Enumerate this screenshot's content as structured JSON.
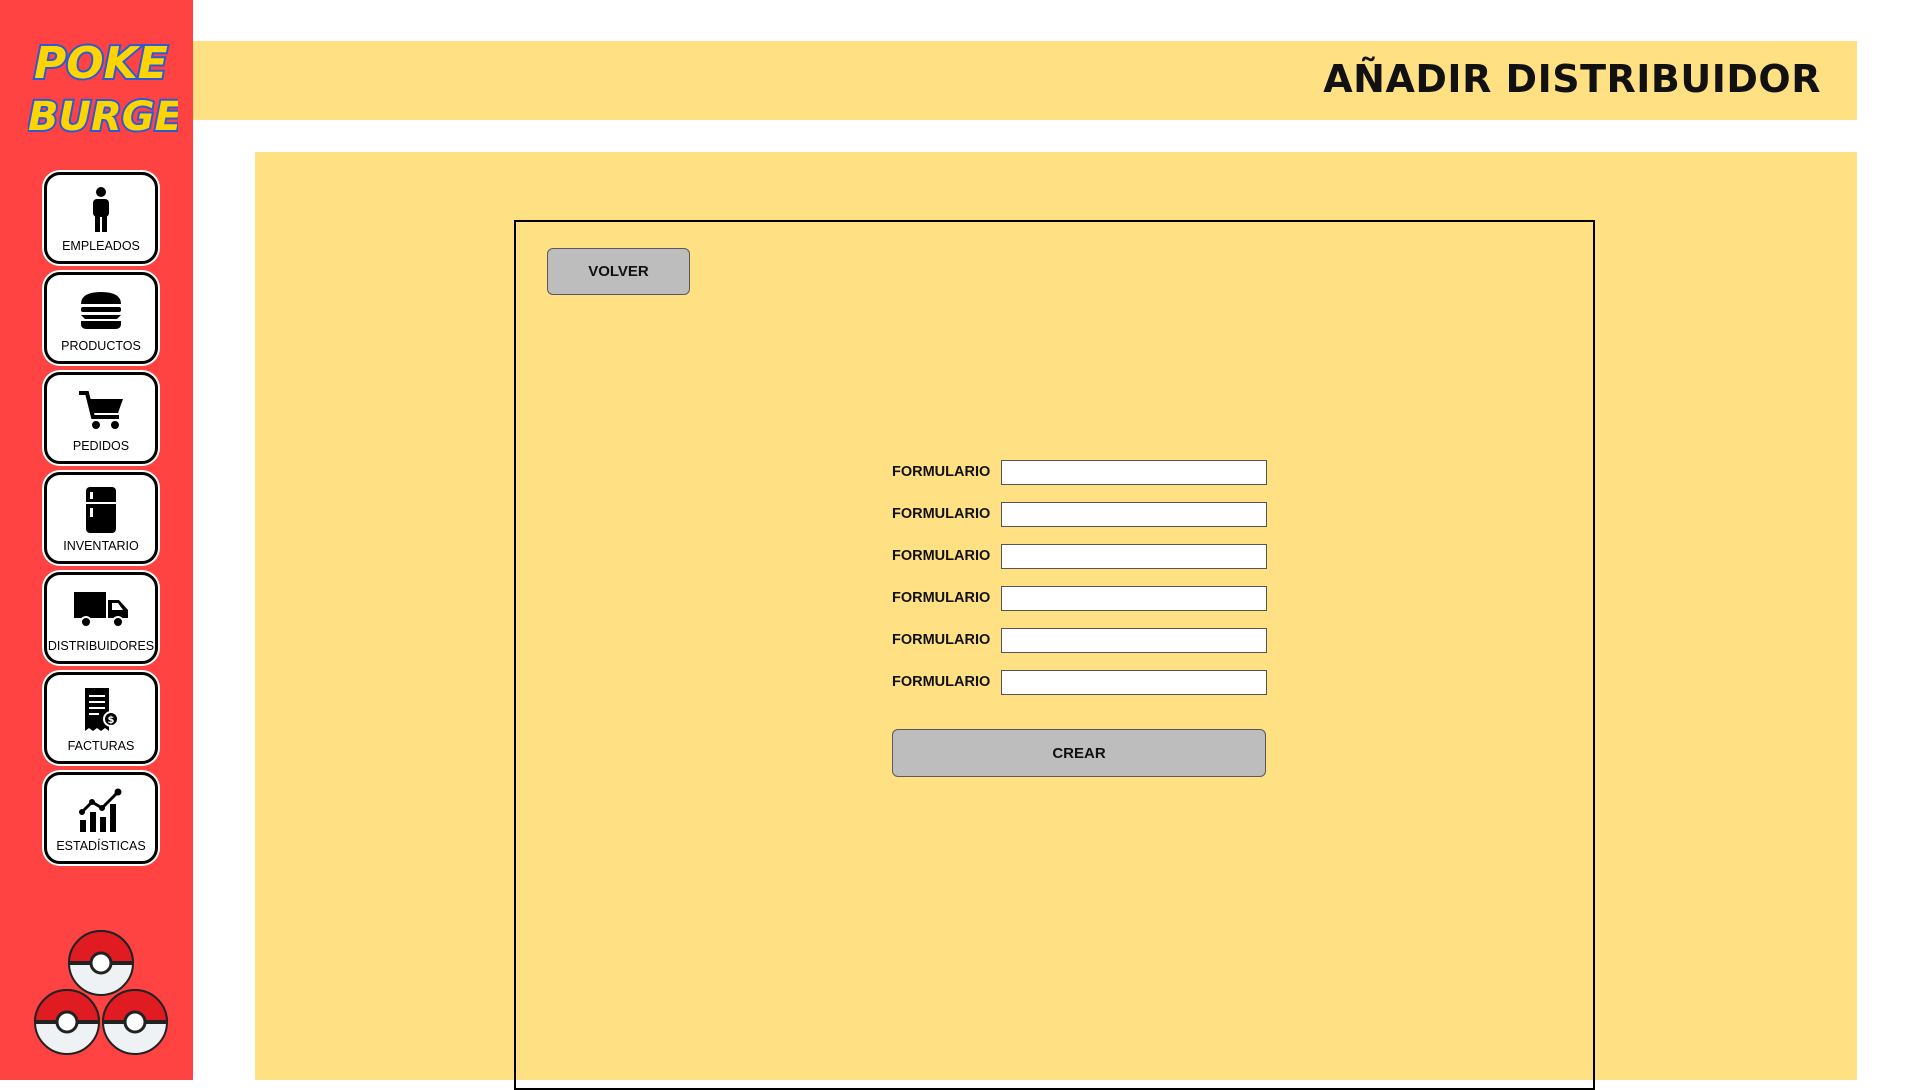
{
  "app": {
    "logo_text": "POKE BURGER",
    "colors": {
      "sidebar": "#ff4242",
      "accent_yellow": "#ffe082",
      "button_gray": "#bdbdbd"
    }
  },
  "sidebar": {
    "items": [
      {
        "label": "EMPLEADOS",
        "icon": "person-icon"
      },
      {
        "label": "PRODUCTOS",
        "icon": "burger-icon"
      },
      {
        "label": "PEDIDOS",
        "icon": "cart-icon"
      },
      {
        "label": "INVENTARIO",
        "icon": "fridge-icon"
      },
      {
        "label": "DISTRIBUIDORES",
        "icon": "truck-icon"
      },
      {
        "label": "FACTURAS",
        "icon": "invoice-icon"
      },
      {
        "label": "ESTADÍSTICAS",
        "icon": "chart-icon"
      }
    ]
  },
  "header": {
    "title": "AÑADIR DISTRIBUIDOR"
  },
  "panel": {
    "back_label": "VOLVER",
    "create_label": "CREAR",
    "fields": [
      {
        "label": "FORMULARIO",
        "value": ""
      },
      {
        "label": "FORMULARIO",
        "value": ""
      },
      {
        "label": "FORMULARIO",
        "value": ""
      },
      {
        "label": "FORMULARIO",
        "value": ""
      },
      {
        "label": "FORMULARIO",
        "value": ""
      },
      {
        "label": "FORMULARIO",
        "value": ""
      }
    ]
  }
}
